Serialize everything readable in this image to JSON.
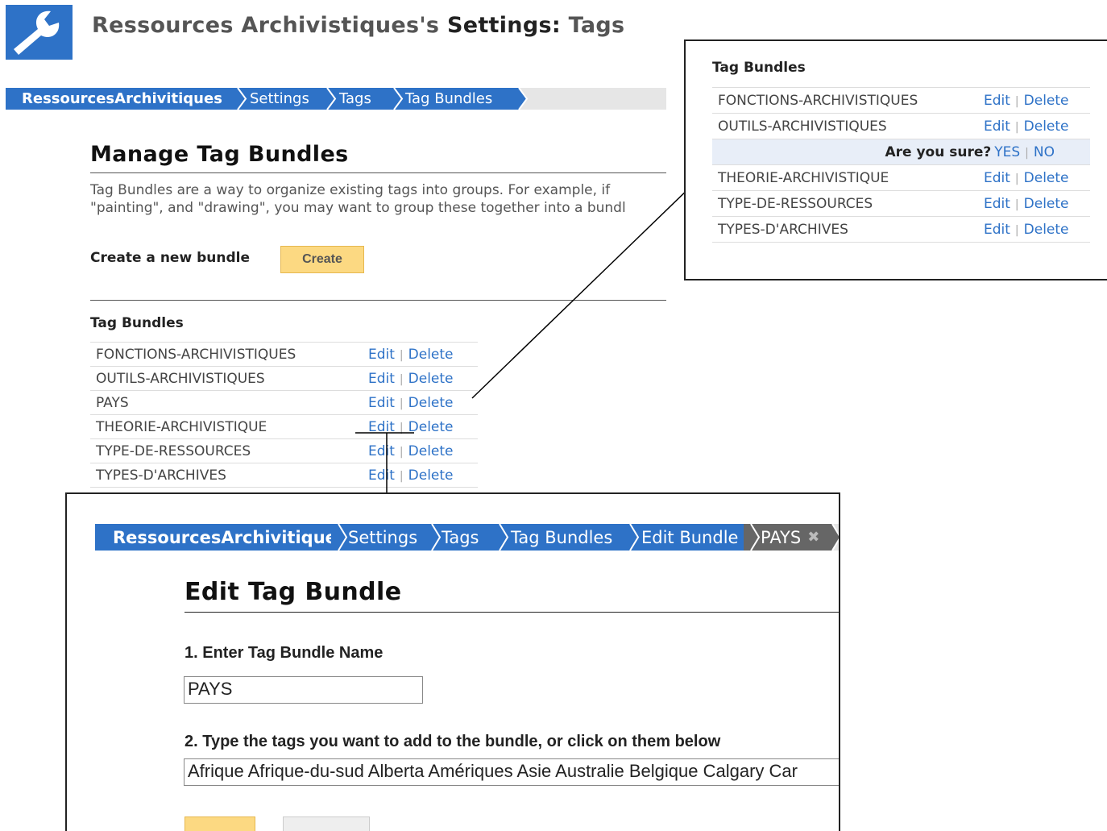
{
  "header": {
    "title_prefix": "Ressources Archivistiques's ",
    "title_settings": "Settings:",
    "title_section": " Tags",
    "logo_icon": "wrench-icon"
  },
  "breadcrumb": [
    "RessourcesArchivitiques",
    "Settings",
    "Tags",
    "Tag Bundles"
  ],
  "manage": {
    "title": "Manage Tag Bundles",
    "intro_line1": "Tag Bundles are a way to organize existing tags into groups. For example, if",
    "intro_line2": "\"painting\", and \"drawing\", you may want to group these together into a bundl",
    "create_label": "Create a new bundle",
    "create_button": "Create",
    "bundles_heading": "Tag Bundles",
    "edit_label": "Edit",
    "delete_label": "Delete",
    "bundles": [
      "FONCTIONS-ARCHIVISTIQUES",
      "OUTILS-ARCHIVISTIQUES",
      "PAYS",
      "THEORIE-ARCHIVISTIQUE",
      "TYPE-DE-RESSOURCES",
      "TYPES-D'ARCHIVES"
    ]
  },
  "zoom": {
    "heading": "Tag Bundles",
    "rows": [
      "FONCTIONS-ARCHIVISTIQUES",
      "OUTILS-ARCHIVISTIQUES",
      "THEORIE-ARCHIVISTIQUE",
      "TYPE-DE-RESSOURCES",
      "TYPES-D'ARCHIVES"
    ],
    "confirm_text": "Are you sure?",
    "confirm_yes": "YES",
    "confirm_no": "NO"
  },
  "edit": {
    "breadcrumb": [
      "RessourcesArchivitiques",
      "Settings",
      "Tags",
      "Tag Bundles",
      "Edit Bundle",
      "PAYS"
    ],
    "close_icon": "close-icon",
    "title": "Edit Tag Bundle",
    "step1_label": "1. Enter Tag Bundle Name",
    "name_value": "PAYS",
    "step2_label": "2. Type the tags you want to add to the bundle, or click on them below",
    "tags_value": "Afrique Afrique-du-sud Alberta Amériques Asie Australie Belgique Calgary Car"
  },
  "colors": {
    "accent": "#2e72c7",
    "button": "#fcd982",
    "crumb_active": "#666666"
  }
}
